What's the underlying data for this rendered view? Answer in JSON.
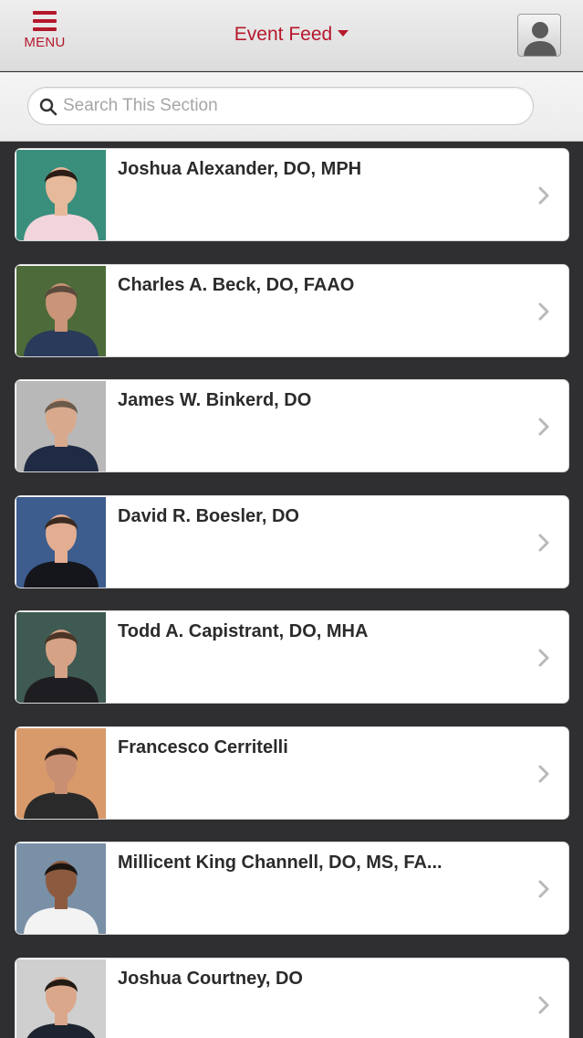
{
  "header": {
    "menu_label": "MENU",
    "title": "Event Feed"
  },
  "search": {
    "placeholder": "Search This Section"
  },
  "colors": {
    "accent": "#b5182b",
    "list_background": "#2f2f31"
  },
  "people": [
    {
      "name": "Joshua Alexander, DO, MPH",
      "photo": "portrait-photo"
    },
    {
      "name": "Charles A. Beck, DO, FAAO",
      "photo": "portrait-photo"
    },
    {
      "name": "James W. Binkerd, DO",
      "photo": "portrait-photo"
    },
    {
      "name": "David R. Boesler, DO",
      "photo": "portrait-photo"
    },
    {
      "name": "Todd A. Capistrant, DO, MHA",
      "photo": "portrait-photo"
    },
    {
      "name": "Francesco Cerritelli",
      "photo": "portrait-photo"
    },
    {
      "name": "Millicent King Channell, DO, MS, FA...",
      "photo": "portrait-photo"
    },
    {
      "name": "Joshua Courtney, DO",
      "photo": "portrait-photo"
    }
  ]
}
